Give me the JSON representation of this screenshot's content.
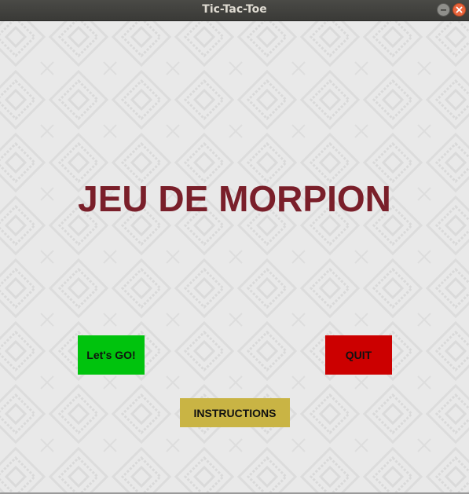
{
  "window": {
    "title": "Tic-Tac-Toe",
    "controls": {
      "minimize_icon": "minimize-icon",
      "close_icon": "close-icon"
    }
  },
  "main": {
    "heading": "JEU DE MORPION",
    "buttons": {
      "start_label": "Let's GO!",
      "quit_label": "QUIT",
      "instructions_label": "INSTRUCTIONS"
    }
  },
  "colors": {
    "heading": "#7a1f2a",
    "start_button": "#00c30d",
    "quit_button": "#cc0000",
    "instructions_button": "#c9b444",
    "background": "#e8e8e8"
  }
}
